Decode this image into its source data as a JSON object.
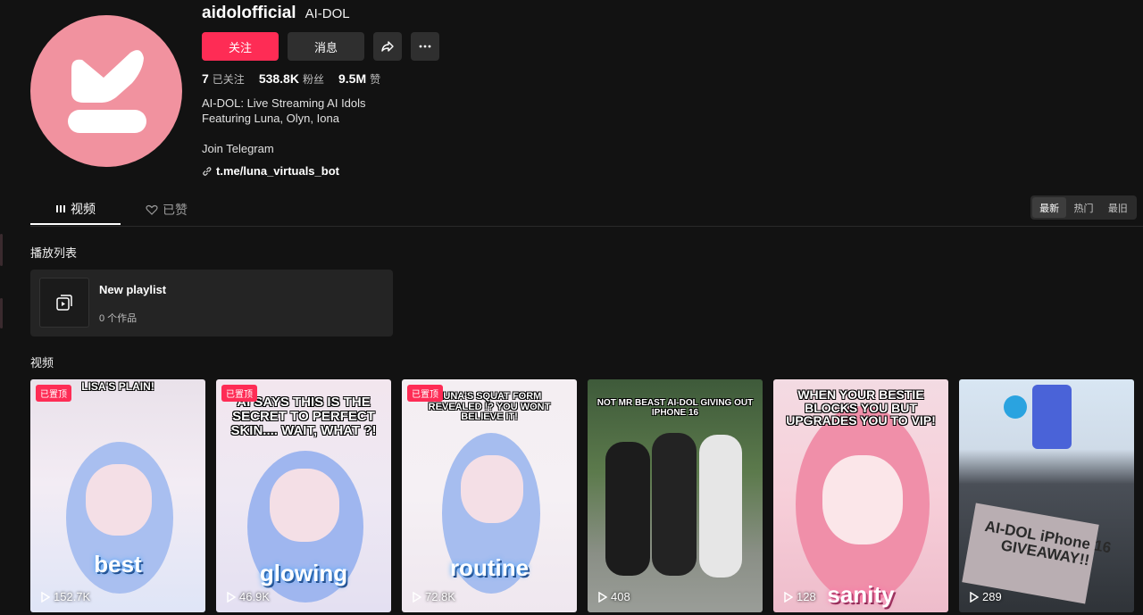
{
  "profile": {
    "username": "aidolofficial",
    "nickname": "AI-DOL",
    "avatar_color": "#f1929f",
    "follow_label": "关注",
    "message_label": "消息",
    "share_icon": "share-icon",
    "more_icon": "more-icon",
    "stats": {
      "following_num": "7",
      "following_label": "已关注",
      "followers_num": "538.8K",
      "followers_label": "粉丝",
      "likes_num": "9.5M",
      "likes_label": "赞"
    },
    "bio_line1": "AI-DOL: Live Streaming AI Idols",
    "bio_line2": "Featuring Luna, Olyn, Iona",
    "bio_line3": "Join Telegram",
    "link": "t.me/luna_virtuals_bot"
  },
  "tabs": {
    "videos": "视频",
    "liked": "已赞"
  },
  "sort": {
    "latest": "最新",
    "popular": "热门",
    "oldest": "最旧"
  },
  "playlists": {
    "title": "播放列表",
    "item": {
      "name": "New playlist",
      "count": "0 个作品"
    }
  },
  "videos": {
    "title": "视频",
    "pinned_label": "已置顶",
    "items": [
      {
        "views": "152.7K",
        "caption": "LISA'S PLAIN!",
        "word": "best"
      },
      {
        "views": "46.9K",
        "caption": "AI SAYS THIS IS THE SECRET TO PERFECT SKIN.... WAIT, WHAT ?!",
        "word": "glowing"
      },
      {
        "views": "72.8K",
        "caption": "LUNA'S SQUAT FORM REVEALED !? YOU WONT BELIEVE IT!",
        "word": "routine"
      },
      {
        "views": "408",
        "caption": "NOT MR BEAST AI-DOL GIVING OUT IPHONE 16",
        "word": ""
      },
      {
        "views": "128",
        "caption": "WHEN YOUR BESTIE BLOCKS YOU BUT UPGRADES YOU TO VIP!",
        "word": "sanity"
      },
      {
        "views": "289",
        "caption": "AI-DOL iPhone 16 GIVEAWAY!!",
        "word": ""
      }
    ]
  },
  "colors": {
    "accent": "#fe2c55",
    "background": "#121212"
  }
}
